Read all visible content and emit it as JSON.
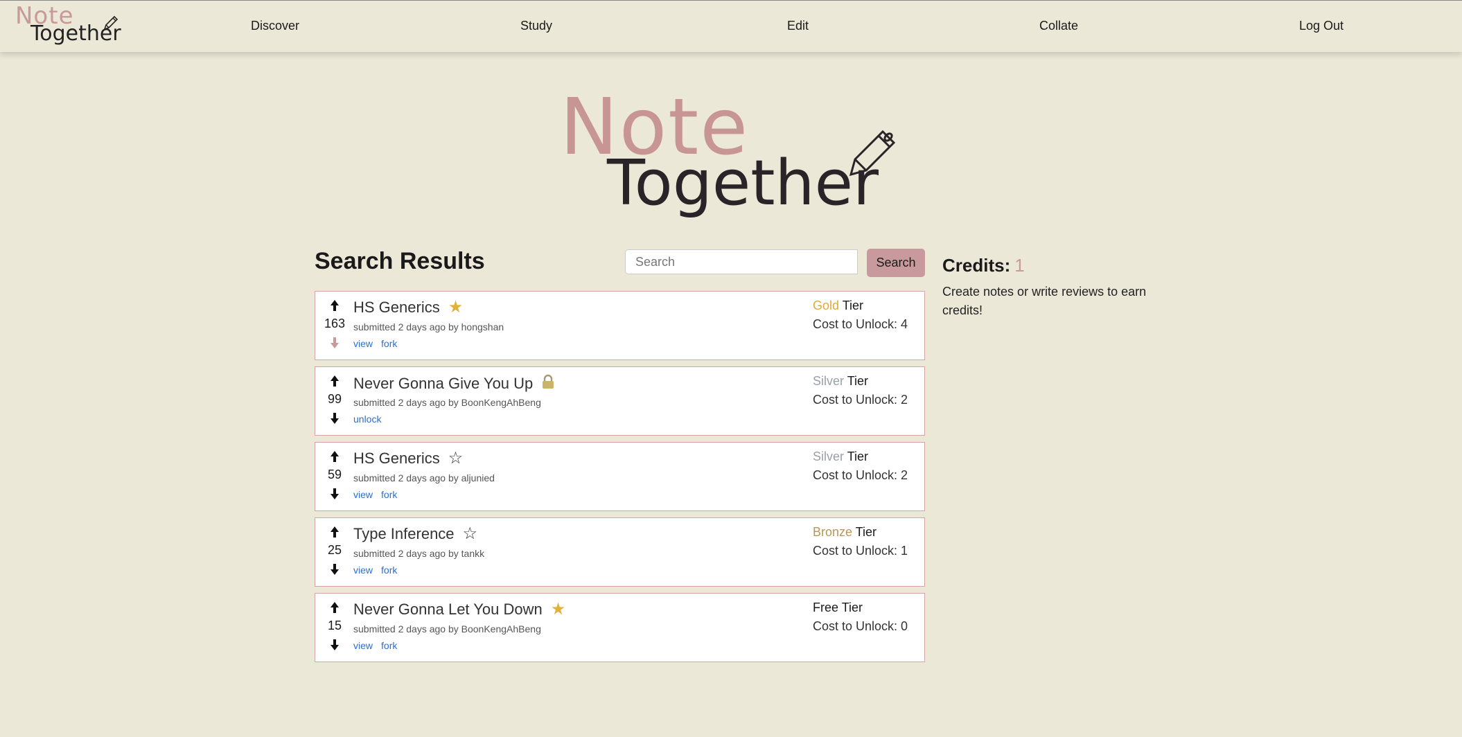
{
  "nav": {
    "logo_top": "Note",
    "logo_bottom": "Together",
    "items": [
      "Discover",
      "Study",
      "Edit",
      "Collate",
      "Log Out"
    ]
  },
  "hero": {
    "top": "Note",
    "bottom": "Together"
  },
  "search": {
    "title": "Search Results",
    "placeholder": "Search",
    "button": "Search"
  },
  "credits": {
    "label": "Credits:",
    "value": "1",
    "note": "Create notes or write reviews to earn credits!"
  },
  "tier_colors": {
    "Gold": "#e0a93a",
    "Silver": "#9aa0a6",
    "Bronze": "#b8955a",
    "Free": "#1a1a1a"
  },
  "results": [
    {
      "title": "HS Generics",
      "badge": "star-filled",
      "score": "163",
      "meta": "submitted 2 days ago by hongshan",
      "actions": [
        "view",
        "fork"
      ],
      "tier": "Gold",
      "tier_suffix": " Tier",
      "cost": "Cost to Unlock: 4",
      "downvoted": true
    },
    {
      "title": "Never Gonna Give You Up",
      "badge": "lock",
      "score": "99",
      "meta": "submitted 2 days ago by BoonKengAhBeng",
      "actions": [
        "unlock"
      ],
      "tier": "Silver",
      "tier_suffix": " Tier",
      "cost": "Cost to Unlock: 2",
      "downvoted": false
    },
    {
      "title": "HS Generics",
      "badge": "star-empty",
      "score": "59",
      "meta": "submitted 2 days ago by aljunied",
      "actions": [
        "view",
        "fork"
      ],
      "tier": "Silver",
      "tier_suffix": " Tier",
      "cost": "Cost to Unlock: 2",
      "downvoted": false
    },
    {
      "title": "Type Inference",
      "badge": "star-empty",
      "score": "25",
      "meta": "submitted 2 days ago by tankk",
      "actions": [
        "view",
        "fork"
      ],
      "tier": "Bronze",
      "tier_suffix": " Tier",
      "cost": "Cost to Unlock: 1",
      "downvoted": false
    },
    {
      "title": "Never Gonna Let You Down",
      "badge": "star-filled",
      "score": "15",
      "meta": "submitted 2 days ago by BoonKengAhBeng",
      "actions": [
        "view",
        "fork"
      ],
      "tier": "Free",
      "tier_suffix": " Tier",
      "cost": "Cost to Unlock: 0",
      "downvoted": false
    }
  ]
}
